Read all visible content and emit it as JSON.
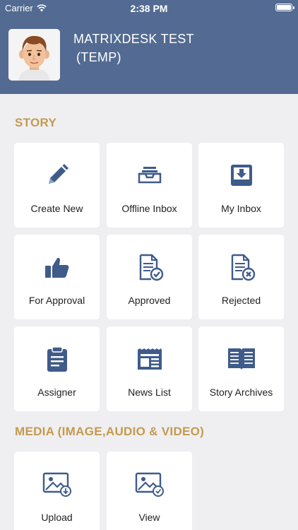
{
  "status_bar": {
    "carrier": "Carrier",
    "time": "2:38 PM"
  },
  "profile": {
    "name_line1": "MATRIXDESK TEST",
    "name_line2": "(TEMP)"
  },
  "colors": {
    "header": "#536b92",
    "accent": "#c49a4e",
    "icon": "#3f5b8a",
    "background": "#efeff1"
  },
  "story": {
    "title": "STORY",
    "tiles": [
      {
        "label": "Create New",
        "icon": "pencil-icon"
      },
      {
        "label": "Offline Inbox",
        "icon": "tray-icon"
      },
      {
        "label": "My Inbox",
        "icon": "inbox-download-icon"
      },
      {
        "label": "For Approval",
        "icon": "thumbs-up-icon"
      },
      {
        "label": "Approved",
        "icon": "document-check-icon"
      },
      {
        "label": "Rejected",
        "icon": "document-x-icon"
      },
      {
        "label": "Assigner",
        "icon": "clipboard-icon"
      },
      {
        "label": "News List",
        "icon": "newspaper-icon"
      },
      {
        "label": "Story Archives",
        "icon": "open-book-icon"
      }
    ]
  },
  "media": {
    "title": "MEDIA (IMAGE,AUDIO & VIDEO)",
    "tiles": [
      {
        "label": "Upload",
        "icon": "image-upload-icon"
      },
      {
        "label": "View",
        "icon": "image-view-icon"
      }
    ]
  }
}
